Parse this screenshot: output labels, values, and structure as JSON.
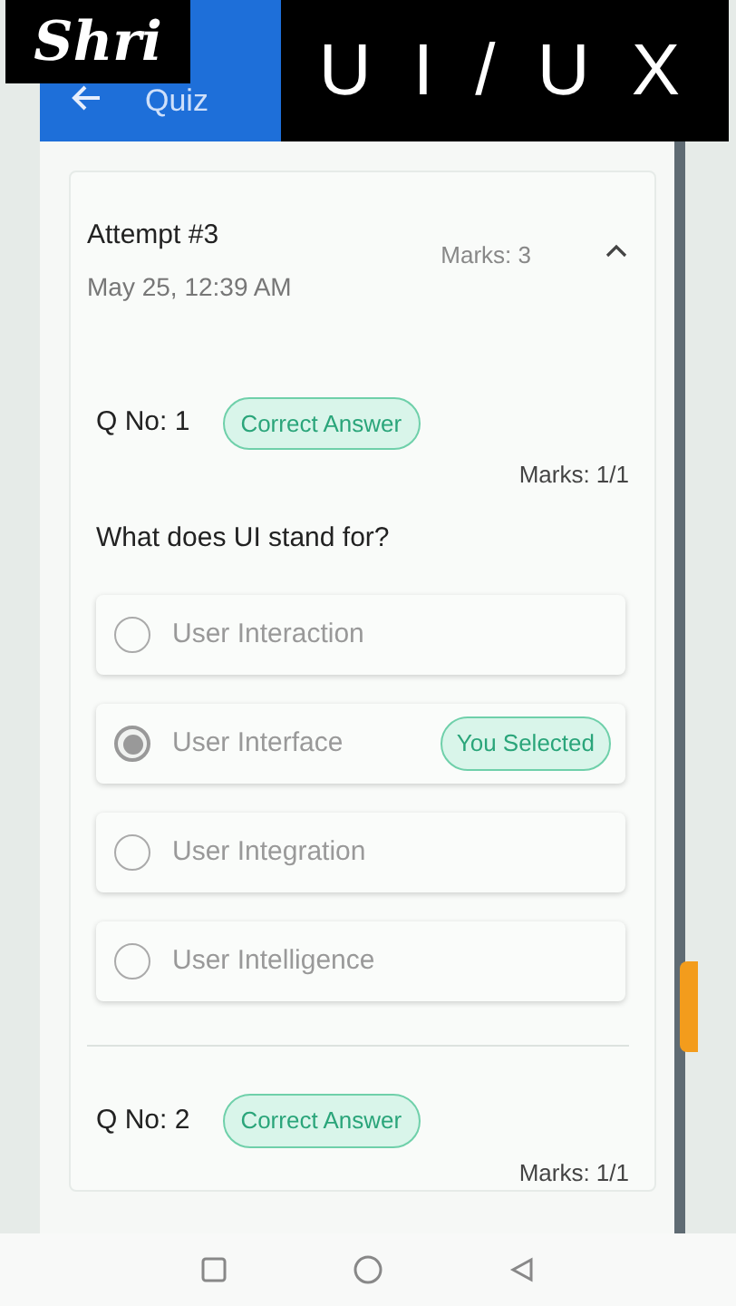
{
  "overlay": {
    "channel": "Shri",
    "caption": "U I / U X"
  },
  "app_bar": {
    "title": "Quiz"
  },
  "attempt": {
    "title": "Attempt #3",
    "date": "May 25, 12:39 AM",
    "marks": "Marks: 3",
    "expanded": true
  },
  "questions": [
    {
      "number": "Q No: 1",
      "result": "Correct Answer",
      "marks": "Marks: 1/1",
      "text": "What does UI stand for?",
      "options": [
        {
          "label": "User Interaction",
          "selected": false
        },
        {
          "label": "User Interface",
          "selected": true,
          "badge": "You Selected"
        },
        {
          "label": "User Integration",
          "selected": false
        },
        {
          "label": "User Intelligence",
          "selected": false
        }
      ]
    },
    {
      "number": "Q No: 2",
      "result": "Correct Answer",
      "marks": "Marks: 1/1"
    }
  ]
}
